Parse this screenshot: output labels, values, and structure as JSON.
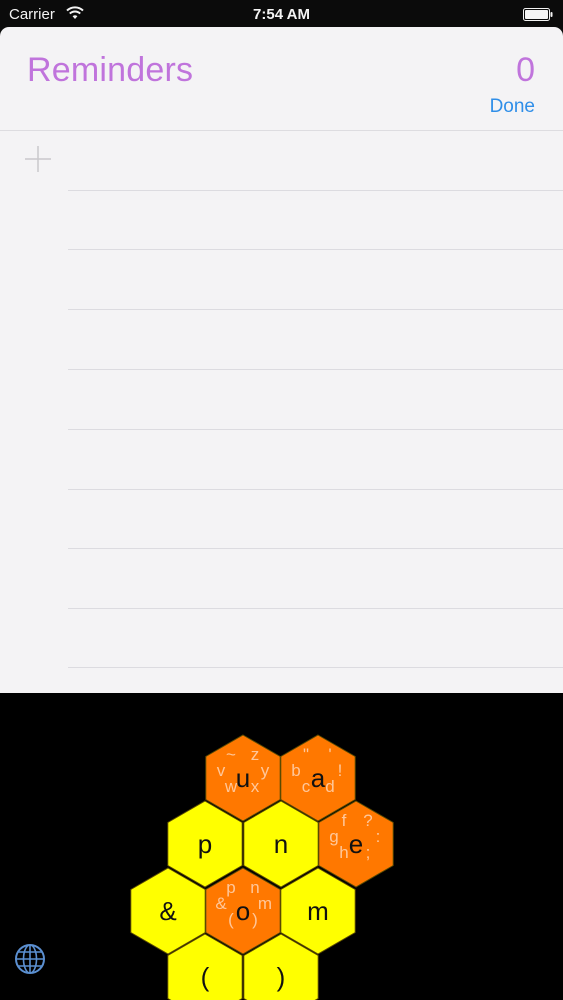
{
  "status": {
    "carrier": "Carrier",
    "time": "7:54 AM"
  },
  "header": {
    "title": "Reminders",
    "count": "0",
    "done": "Done"
  },
  "colors": {
    "accent": "#c074dc",
    "link": "#2f8ee8",
    "hex_yellow": "#ffff00",
    "hex_orange": "#ff7800"
  },
  "keyboard": {
    "keys": [
      {
        "name": "hex-key-u",
        "label": "u",
        "color": "orange",
        "sub": [
          "~",
          "z",
          "v",
          "y",
          "w",
          "x"
        ]
      },
      {
        "name": "hex-key-a",
        "label": "a",
        "color": "orange",
        "sub": [
          "\"",
          "'",
          "b",
          "!",
          "c",
          "d"
        ]
      },
      {
        "name": "hex-key-p",
        "label": "p",
        "color": "yellow",
        "sub": []
      },
      {
        "name": "hex-key-n",
        "label": "n",
        "color": "yellow",
        "sub": []
      },
      {
        "name": "hex-key-e",
        "label": "e",
        "color": "orange",
        "sub": [
          "f",
          "?",
          "g",
          ":",
          "h",
          ";"
        ]
      },
      {
        "name": "hex-key-ampersand",
        "label": "&",
        "color": "yellow",
        "sub": []
      },
      {
        "name": "hex-key-o",
        "label": "o",
        "color": "orange",
        "sub": [
          "p",
          "n",
          "&",
          "m",
          "(",
          ")"
        ]
      },
      {
        "name": "hex-key-m",
        "label": "m",
        "color": "yellow",
        "sub": []
      },
      {
        "name": "hex-key-open-paren",
        "label": "(",
        "color": "yellow",
        "sub": []
      },
      {
        "name": "hex-key-close-paren",
        "label": ")",
        "color": "yellow",
        "sub": []
      }
    ],
    "globe_icon": "globe-icon"
  }
}
